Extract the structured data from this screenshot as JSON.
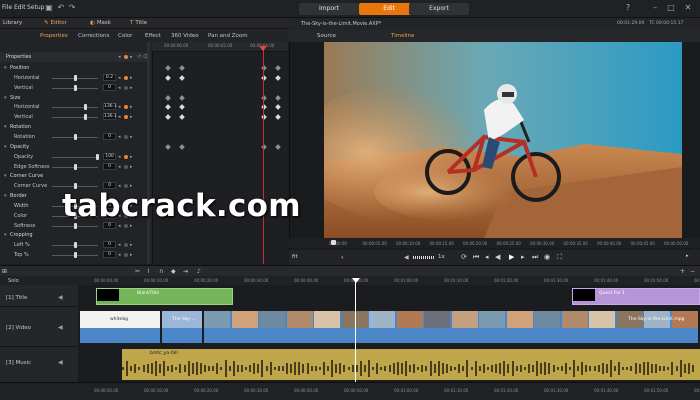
{
  "menu": [
    "File",
    "Edit",
    "Setup"
  ],
  "modes": {
    "import": "Import",
    "edit": "Edit",
    "export": "Export"
  },
  "left_tabs": {
    "library": "Library",
    "editor": "Editor",
    "mask": "Mask",
    "title": "Title"
  },
  "sub_tabs": [
    "Properties",
    "Corrections",
    "Color",
    "Effect",
    "360 Video",
    "Pan and Zoom"
  ],
  "props_header": "Properties",
  "properties": [
    {
      "label": "Position",
      "type": "section"
    },
    {
      "label": "Horizontal",
      "value": "0.2"
    },
    {
      "label": "Vertical",
      "value": "0"
    },
    {
      "label": "Size",
      "type": "section"
    },
    {
      "label": "Horizontal",
      "value": "136.1"
    },
    {
      "label": "Vertical",
      "value": "136.1"
    },
    {
      "label": "Rotation",
      "type": "section"
    },
    {
      "label": "Rotation",
      "value": "0"
    },
    {
      "label": "Opacity",
      "type": "section"
    },
    {
      "label": "Opacity",
      "value": "100"
    },
    {
      "label": "Edge Softness",
      "value": "0"
    },
    {
      "label": "Corner Curve",
      "type": "section"
    },
    {
      "label": "Corner Curve",
      "value": "0"
    },
    {
      "label": "Border",
      "type": "section"
    },
    {
      "label": "Width",
      "value": "0"
    },
    {
      "label": "Color",
      "value": "0"
    },
    {
      "label": "Softness",
      "value": "0"
    },
    {
      "label": "Cropping",
      "type": "section"
    },
    {
      "label": "Left %",
      "value": "0"
    },
    {
      "label": "Top %",
      "value": "0"
    }
  ],
  "kf_ruler": [
    "00:00:00.00",
    "00:00:02.00",
    "00:00:04.00"
  ],
  "viewer": {
    "filename": "The-Sky-is-the-Limit.Movie.AXP*",
    "timecode_left": "00:01:29.09",
    "timecode_right": "TC 00:00:15.17",
    "tab_source": "Source",
    "tab_timeline": "Timeline",
    "fit_label": "fit",
    "speed_label": "1x",
    "ruler": [
      "00:00:00",
      "00:00:05.00",
      "00:00:10.00",
      "00:00:15.00",
      "00:00:20.00",
      "00:00:25.00",
      "00:00:30.00",
      "00:00:35.00",
      "00:00:40.00",
      "00:00:45.00",
      "00:00:50.00"
    ]
  },
  "watermark": "tabcrack.com",
  "timeline": {
    "solo_label": "Solo",
    "tracks": [
      {
        "name": "[1] Title"
      },
      {
        "name": "[2] Video"
      },
      {
        "name": "[3] Music"
      }
    ],
    "clip_labels": {
      "title1": "BlankTitle",
      "title2": "Quest For 1",
      "video1": "whitebg",
      "video2": "The-Sky-...",
      "video3": "The-Sky-is-the-Limit.mpg",
      "music": "bmtc_ya-fall"
    },
    "ruler": [
      "00:00:00.00",
      "00:00:10.00",
      "00:00:20.00",
      "00:00:30.00",
      "00:00:40.00",
      "00:00:50.00",
      "00:01:00.00",
      "00:01:10.00",
      "00:01:20.00",
      "00:01:30.00",
      "00:01:40.00",
      "00:01:50.00",
      "00:02:00.00"
    ]
  },
  "colors": {
    "accent": "#e8760a",
    "title_clip": "#74b45a",
    "video_clip": "#4a86c8",
    "music_clip": "#bfa64a",
    "playhead": "#c8342c"
  }
}
